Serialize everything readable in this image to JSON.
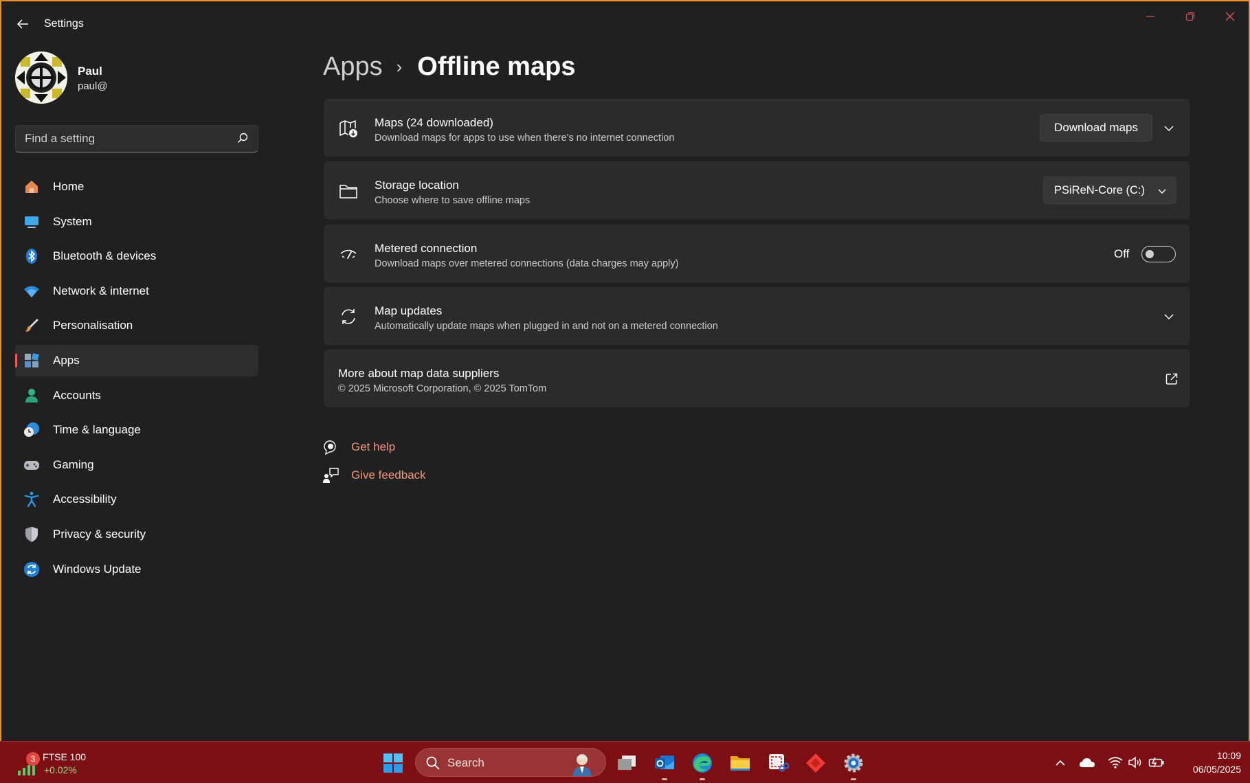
{
  "window": {
    "title": "Settings"
  },
  "profile": {
    "name": "Paul",
    "email": "paul@"
  },
  "search": {
    "placeholder": "Find a setting"
  },
  "sidebar": {
    "items": [
      {
        "label": "Home",
        "icon": "home-icon"
      },
      {
        "label": "System",
        "icon": "system-icon"
      },
      {
        "label": "Bluetooth & devices",
        "icon": "bluetooth-icon"
      },
      {
        "label": "Network & internet",
        "icon": "wifi-icon"
      },
      {
        "label": "Personalisation",
        "icon": "brush-icon"
      },
      {
        "label": "Apps",
        "icon": "apps-icon",
        "selected": true
      },
      {
        "label": "Accounts",
        "icon": "account-icon"
      },
      {
        "label": "Time & language",
        "icon": "clock-globe-icon"
      },
      {
        "label": "Gaming",
        "icon": "gamepad-icon"
      },
      {
        "label": "Accessibility",
        "icon": "accessibility-icon"
      },
      {
        "label": "Privacy & security",
        "icon": "shield-icon"
      },
      {
        "label": "Windows Update",
        "icon": "update-icon"
      }
    ]
  },
  "breadcrumb": {
    "parent": "Apps",
    "separator": "›",
    "current": "Offline maps"
  },
  "cards": {
    "maps": {
      "title": "Maps (24 downloaded)",
      "description": "Download maps for apps to use when there's no internet connection",
      "button": "Download maps"
    },
    "storage": {
      "title": "Storage location",
      "description": "Choose where to save offline maps",
      "selected_drive": "PSiReN-Core (C:)"
    },
    "metered": {
      "title": "Metered connection",
      "description": "Download maps over metered connections (data charges may apply)",
      "toggle_label": "Off",
      "enabled": false
    },
    "updates": {
      "title": "Map updates",
      "description": "Automatically update maps when plugged in and not on a metered connection"
    },
    "suppliers": {
      "title": "More about map data suppliers",
      "description": "© 2025 Microsoft Corporation, © 2025 TomTom"
    }
  },
  "help": {
    "get_help": "Get help",
    "give_feedback": "Give feedback"
  },
  "taskbar": {
    "widget": {
      "name": "FTSE 100",
      "value": "+0.02%",
      "badge": "3"
    },
    "search_label": "Search",
    "clock_time": "10:09",
    "clock_date": "06/05/2025"
  },
  "colors": {
    "accent": "#f3967d",
    "selection_marker": "#f35a5a",
    "taskbar": "#7d0e13",
    "window_border": "#e8902a"
  }
}
